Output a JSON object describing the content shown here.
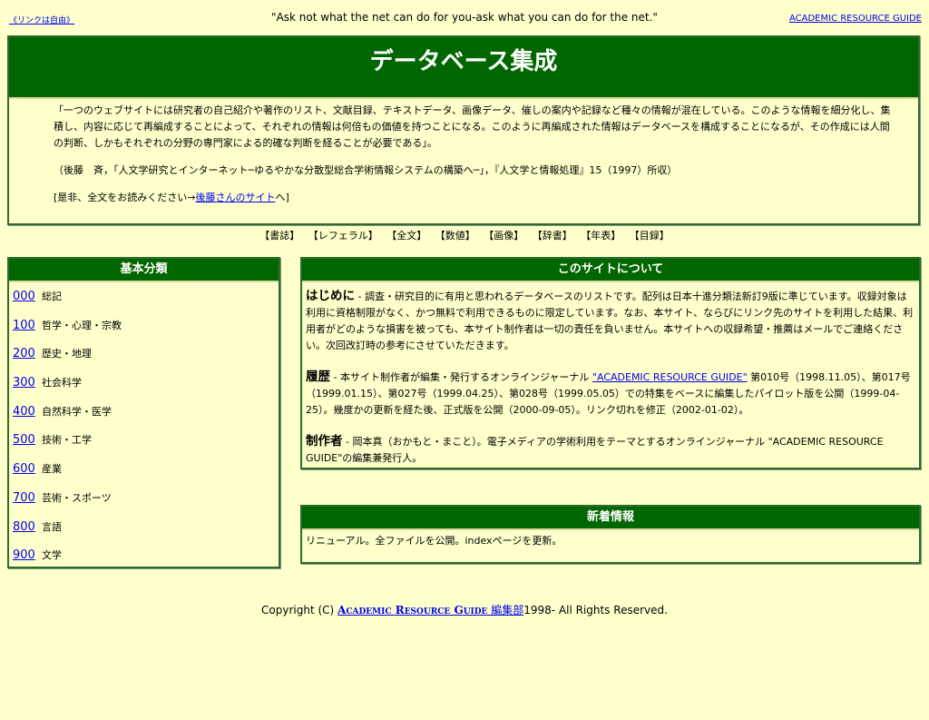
{
  "top": {
    "link_free": "《リンクは自由》",
    "quote": "\"Ask not what the net can do for you-ask what you can do for the net.\"",
    "arg_link": "ACADEMIC RESOURCE GUIDE"
  },
  "hero": {
    "title": "データベース集成",
    "para1": "「一つのウェブサイトには研究者の自己紹介や著作のリスト、文献目録、テキストデータ、画像データ、催しの案内や記録など種々の情報が混在している。このような情報を細分化し、集積し、内容に応じて再編成することによって、それぞれの情報は何倍もの価値を持つことになる。このように再編成された情報はデータベースを構成することになるが、その作成には人間の判断、しかもそれぞれの分野の専門家による的確な判断を経ることが必要である」。",
    "citation": "（後藤　斉，「人文学研究とインターネット─ゆるやかな分散型総合学術情報システムの構築へ─」，『人文学と情報処理』15（1997）所収）",
    "read_prefix": "[是非、全文をお読みください→",
    "read_link": "後藤さんのサイト",
    "read_suffix": "へ]"
  },
  "catnav": [
    "【書誌】",
    "【レフェラル】",
    "【全文】",
    "【数値】",
    "【画像】",
    "【辞書】",
    "【年表】",
    "【目録】"
  ],
  "classification": {
    "title": "基本分類",
    "items": [
      {
        "code": "000",
        "label": "総記"
      },
      {
        "code": "100",
        "label": "哲学・心理・宗教"
      },
      {
        "code": "200",
        "label": "歴史・地理"
      },
      {
        "code": "300",
        "label": "社会科学"
      },
      {
        "code": "400",
        "label": "自然科学・医学"
      },
      {
        "code": "500",
        "label": "技術・工学"
      },
      {
        "code": "600",
        "label": "産業"
      },
      {
        "code": "700",
        "label": "芸術・スポーツ"
      },
      {
        "code": "800",
        "label": "言語"
      },
      {
        "code": "900",
        "label": "文学"
      }
    ]
  },
  "about": {
    "title": "このサイトについて",
    "intro_head": "はじめに",
    "intro_text": " - 調査・研究目的に有用と思われるデータベースのリストです。配列は日本十進分類法新訂9版に準じています。収録対象は利用に資格制限がなく、かつ無料で利用できるものに限定しています。なお、本サイト、ならびにリンク先のサイトを利用した結果、利用者がどのような損害を被っても、本サイト制作者は一切の責任を負いません。本サイトへの収録希望・推薦はメールでご連絡ください。次回改訂時の参考にさせていただきます。",
    "history_head": "履歴",
    "history_pre": " - 本サイト制作者が編集・発行するオンラインジャーナル ",
    "history_link": "\"ACADEMIC RESOURCE GUIDE\"",
    "history_post": " 第010号（1998.11.05）、第017号（1999.01.15）、第027号（1999.04.25）、第028号（1999.05.05）での特集をベースに編集したパイロット版を公開（1999-04-25）。幾度かの更新を経た後、正式版を公開（2000-09-05）。リンク切れを修正（2002-01-02）。",
    "author_head": "制作者",
    "author_text": " - 岡本真（おかもと・まこと）。電子メディアの学術利用をテーマとするオンラインジャーナル \"ACADEMIC RESOURCE GUIDE\"の編集兼発行人。"
  },
  "news": {
    "title": "新着情報",
    "text": "リニューアル。全ファイルを公開。indexページを更新。"
  },
  "copyright": {
    "prefix": "Copyright (C) ",
    "link_a": "A",
    "link_cademic": "CADEMIC",
    "link_r": "R",
    "link_esource": "ESOURCE",
    "link_g": "G",
    "link_uide": "UIDE",
    "link_tail": " 編集部",
    "suffix": "1998- All Rights Reserved."
  }
}
